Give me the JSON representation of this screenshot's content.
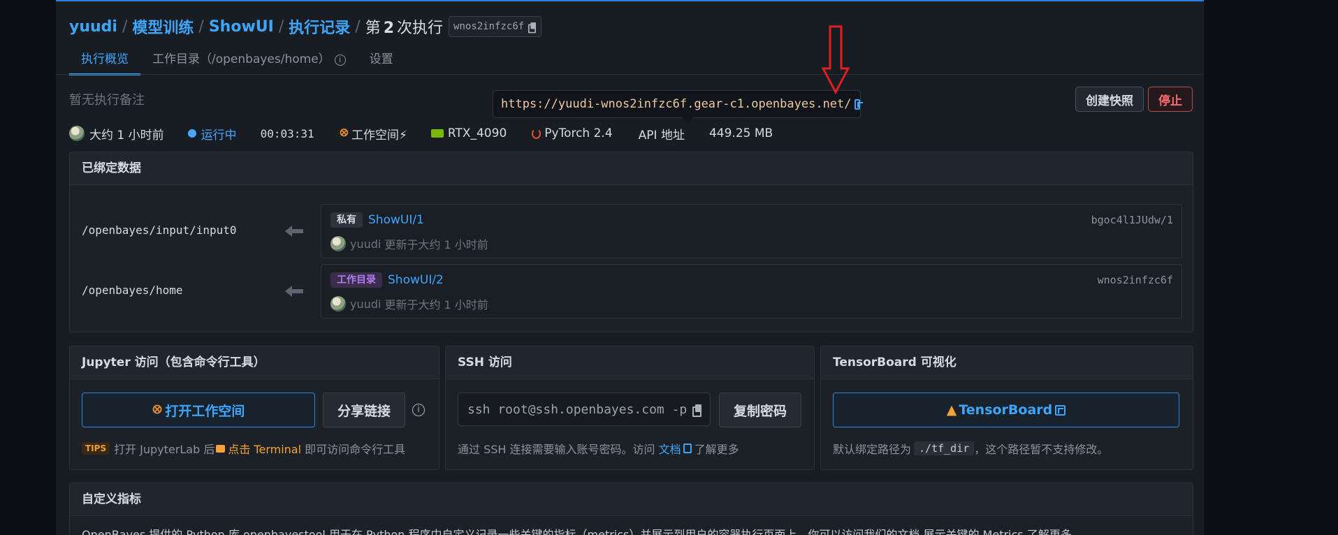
{
  "breadcrumb": {
    "user": "yuudi",
    "section": "模型训练",
    "project": "ShowUI",
    "records": "执行记录",
    "current_prefix": "第",
    "current_num": "2",
    "current_suffix": "次执行",
    "run_id": "wnos2infzc6f"
  },
  "tabs": [
    {
      "label": "执行概览"
    },
    {
      "label": "工作目录（/openbayes/home）"
    },
    {
      "label": "设置"
    }
  ],
  "note": "暂无执行备注",
  "actions": {
    "snapshot": "创建快照",
    "stop": "停止"
  },
  "url_tooltip": "https://yuudi-wnos2infzc6f.gear-c1.openbayes.net/",
  "status": {
    "created": "大约 1 小时前",
    "state": "运行中",
    "elapsed": "00:03:31",
    "workspace": "工作空间⚡",
    "gpu": "RTX_4090",
    "framework": "PyTorch 2.4",
    "api": "API 地址",
    "size": "449.25 MB"
  },
  "bound_data": {
    "title": "已绑定数据",
    "rows": [
      {
        "path": "/openbayes/input/input0",
        "badge": "私有",
        "name": "ShowUI/1",
        "id": "bgoc4l1JUdw/1",
        "user": "yuudi",
        "updated": "更新于大约 1 小时前"
      },
      {
        "path": "/openbayes/home",
        "badge": "工作目录",
        "name": "ShowUI/2",
        "id": "wnos2infzc6f",
        "user": "yuudi",
        "updated": "更新于大约 1 小时前"
      }
    ]
  },
  "jupyter": {
    "title": "Jupyter 访问（包含命令行工具）",
    "open_button": "打开工作空间",
    "share_button": "分享链接",
    "tips": "TIPS",
    "help_1": "打开 JupyterLab 后",
    "help_highlight": "点击 Terminal",
    "help_2": "即可访问命令行工具"
  },
  "ssh": {
    "title": "SSH 访问",
    "command": "ssh root@ssh.openbayes.com -p",
    "copy_password": "复制密码",
    "help_1": "通过 SSH 连接需要输入账号密码。访问",
    "help_link": "文档",
    "help_2": "了解更多"
  },
  "tensorboard": {
    "title": "TensorBoard 可视化",
    "button": "TensorBoard",
    "help_1": "默认绑定路径为",
    "help_code": "./tf_dir",
    "help_2": "，这个路径暂不支持修改。"
  },
  "metrics": {
    "title": "自定义指标",
    "body": "OpenBayes 提供的 Python 库 openbayestool 用于在 Python 程序中自定义记录一些关键的指标（metrics）并展示到用户的容器执行页面上。你可以访问我们的文档 展示关键的 Metrics 了解更多"
  },
  "colors": {
    "accent": "#3ea6ff",
    "stop": "#ff6b6b",
    "annotation_arrow": "#e02020"
  }
}
